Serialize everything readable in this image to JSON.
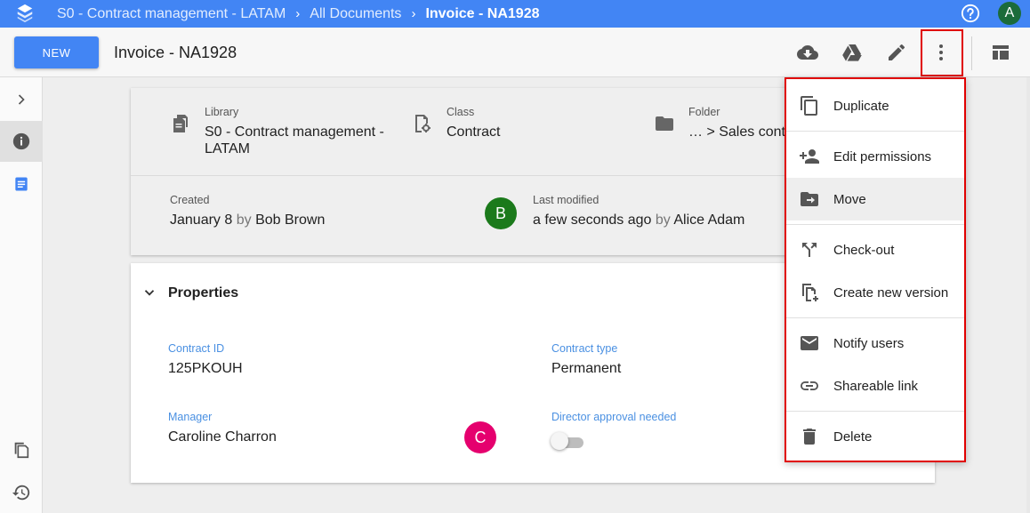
{
  "breadcrumb": [
    "S0 - Contract management - LATAM",
    "All Documents",
    "Invoice - NA1928"
  ],
  "user_avatar": "A",
  "toolbar": {
    "new_label": "NEW",
    "doc_title": "Invoice - NA1928",
    "icons": [
      "cloud-download-icon",
      "google-drive-icon",
      "edit-icon",
      "more-vert-icon",
      "layout-icon"
    ]
  },
  "summary": {
    "library_label": "Library",
    "library_value_line1": "S0 - Contract management -",
    "library_value_line2": "LATAM",
    "class_label": "Class",
    "class_value": "Contract",
    "folder_label": "Folder",
    "folder_value": "… > Sales contra",
    "created_label": "Created",
    "created_date": "January 8",
    "created_by_word": "by",
    "created_by": "Bob Brown",
    "modified_label": "Last modified",
    "modified_when": "a few seconds ago",
    "modified_by_word": "by",
    "modified_by": "Alice Adam"
  },
  "properties": {
    "title": "Properties",
    "contract_id_label": "Contract ID",
    "contract_id_value": "125PKOUH",
    "contract_type_label": "Contract type",
    "contract_type_value": "Permanent",
    "manager_label": "Manager",
    "manager_value": "Caroline Charron",
    "director_label": "Director approval needed"
  },
  "overlay_badges": {
    "b": "B",
    "c": "C"
  },
  "menu": {
    "items": [
      "Duplicate",
      "Edit permissions",
      "Move",
      "Check-out",
      "Create new version",
      "Notify users",
      "Shareable link",
      "Delete"
    ]
  },
  "colors": {
    "primary": "#4285f4",
    "highlight": "#e00000",
    "label_blue": "#4a90e2",
    "badge_green": "#1b7a1b",
    "badge_pink": "#e5006e"
  }
}
